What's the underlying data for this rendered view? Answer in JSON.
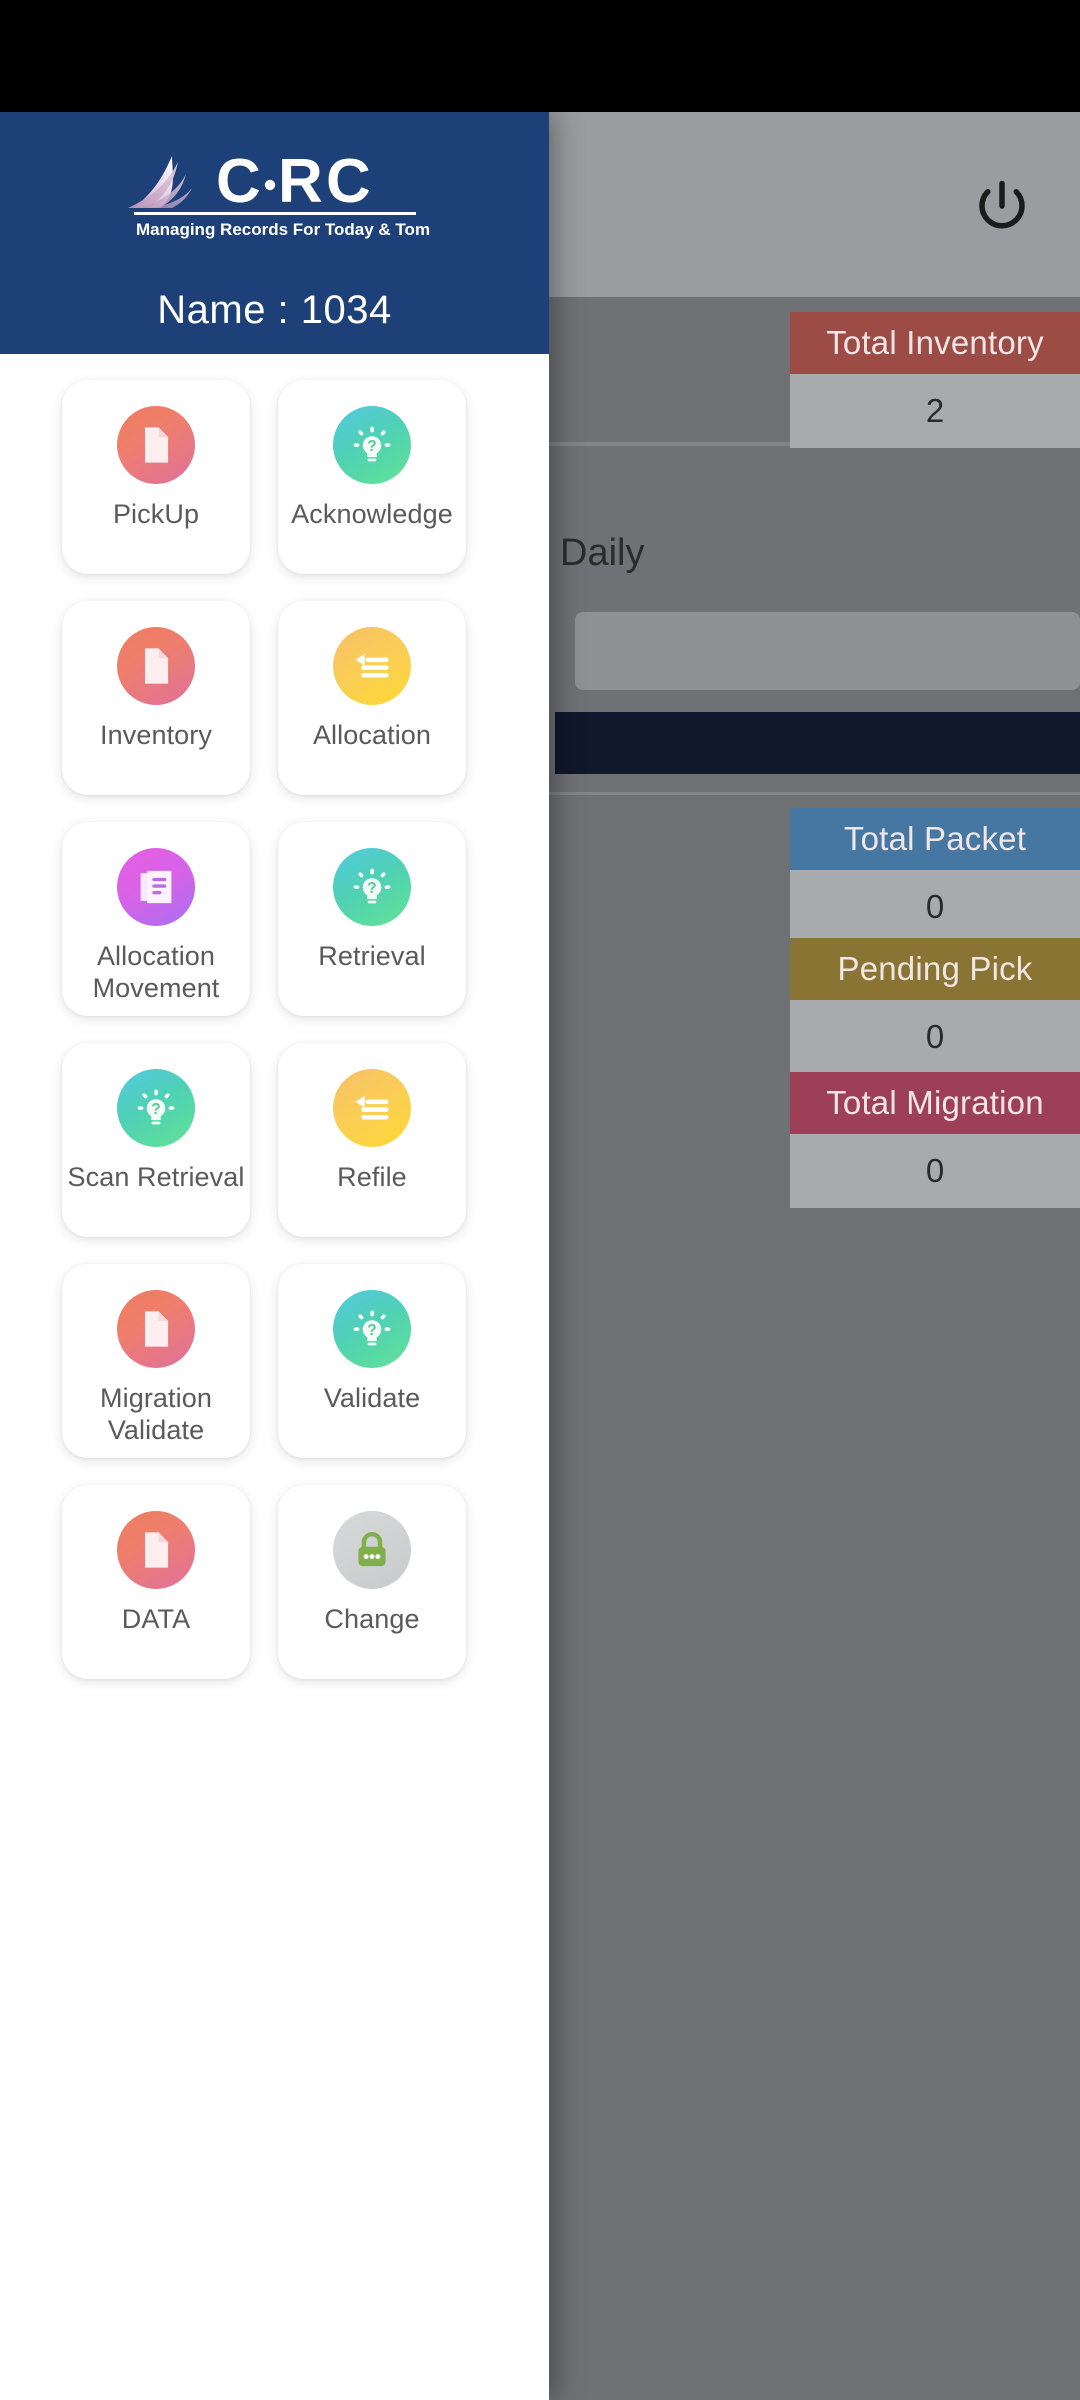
{
  "brand": {
    "logo_text": "CRC",
    "tagline": "Managing Records For Today & Tomorrow",
    "header_color": "#1e4078"
  },
  "drawer": {
    "user_label": "Name : 1034",
    "items": [
      {
        "label": "PickUp",
        "icon": "document-icon",
        "style": "g-doc"
      },
      {
        "label": "Acknowledge",
        "icon": "lightbulb-question-icon",
        "style": "g-bulb"
      },
      {
        "label": "Inventory",
        "icon": "document-icon",
        "style": "g-doc"
      },
      {
        "label": "Allocation",
        "icon": "list-arrow-icon",
        "style": "g-list"
      },
      {
        "label": "Allocation Movement",
        "icon": "stacked-documents-icon",
        "style": "g-stack"
      },
      {
        "label": "Retrieval",
        "icon": "lightbulb-question-icon",
        "style": "g-bulb"
      },
      {
        "label": "Scan Retrieval",
        "icon": "lightbulb-question-icon",
        "style": "g-bulb"
      },
      {
        "label": "Refile",
        "icon": "list-arrow-icon",
        "style": "g-list"
      },
      {
        "label": "Migration Validate",
        "icon": "document-icon",
        "style": "g-doc"
      },
      {
        "label": "Validate",
        "icon": "lightbulb-question-icon",
        "style": "g-bulb"
      },
      {
        "label": "DATA",
        "icon": "document-icon",
        "style": "g-doc"
      },
      {
        "label": "Change",
        "icon": "lock-icon",
        "style": "g-lock"
      }
    ]
  },
  "dashboard": {
    "power_icon": "power-icon",
    "daily_label": "Daily",
    "tiles": [
      {
        "title": "Total Inventory",
        "value": "2",
        "color": "#9d4b45"
      },
      {
        "title": "Total Packet",
        "value": "0",
        "color": "#4677a3"
      },
      {
        "title": "Pending Pick",
        "value": "0",
        "color": "#8a7433"
      },
      {
        "title": "Total Migration",
        "value": "0",
        "color": "#9d3f56"
      }
    ]
  }
}
